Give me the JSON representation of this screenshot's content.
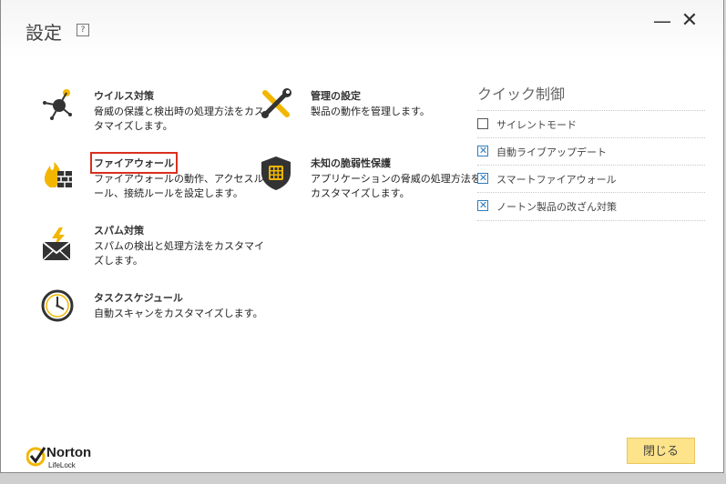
{
  "window": {
    "title": "設定",
    "help": "?",
    "minimize": "—",
    "close": "✕"
  },
  "items": {
    "virus": {
      "name": "ウイルス対策",
      "desc": "脅威の保護と検出時の処理方法をカスタマイズします。"
    },
    "admin": {
      "name": "管理の設定",
      "desc": "製品の動作を管理します。"
    },
    "firewall": {
      "name": "ファイアウォール",
      "desc": "ファイアウォールの動作、アクセスルール、接続ルールを設定します。"
    },
    "vuln": {
      "name": "未知の脆弱性保護",
      "desc": "アプリケーションの脅威の処理方法をカスタマイズします。"
    },
    "spam": {
      "name": "スパム対策",
      "desc": "スパムの検出と処理方法をカスタマイズします。"
    },
    "schedule": {
      "name": "タスクスケジュール",
      "desc": "自動スキャンをカスタマイズします。"
    }
  },
  "quick": {
    "title": "クイック制御",
    "rows": [
      {
        "label": "サイレントモード",
        "checked": false
      },
      {
        "label": "自動ライブアップデート",
        "checked": true
      },
      {
        "label": "スマートファイアウォール",
        "checked": true
      },
      {
        "label": "ノートン製品の改ざん対策",
        "checked": true
      }
    ]
  },
  "footer": {
    "logo_name": "Norton",
    "logo_sub": "LifeLock",
    "close_label": "閉じる"
  },
  "colors": {
    "accent": "#2d7dbd",
    "button": "#fde38a",
    "highlight": "#d9301f",
    "icon_yellow": "#f2b600"
  }
}
